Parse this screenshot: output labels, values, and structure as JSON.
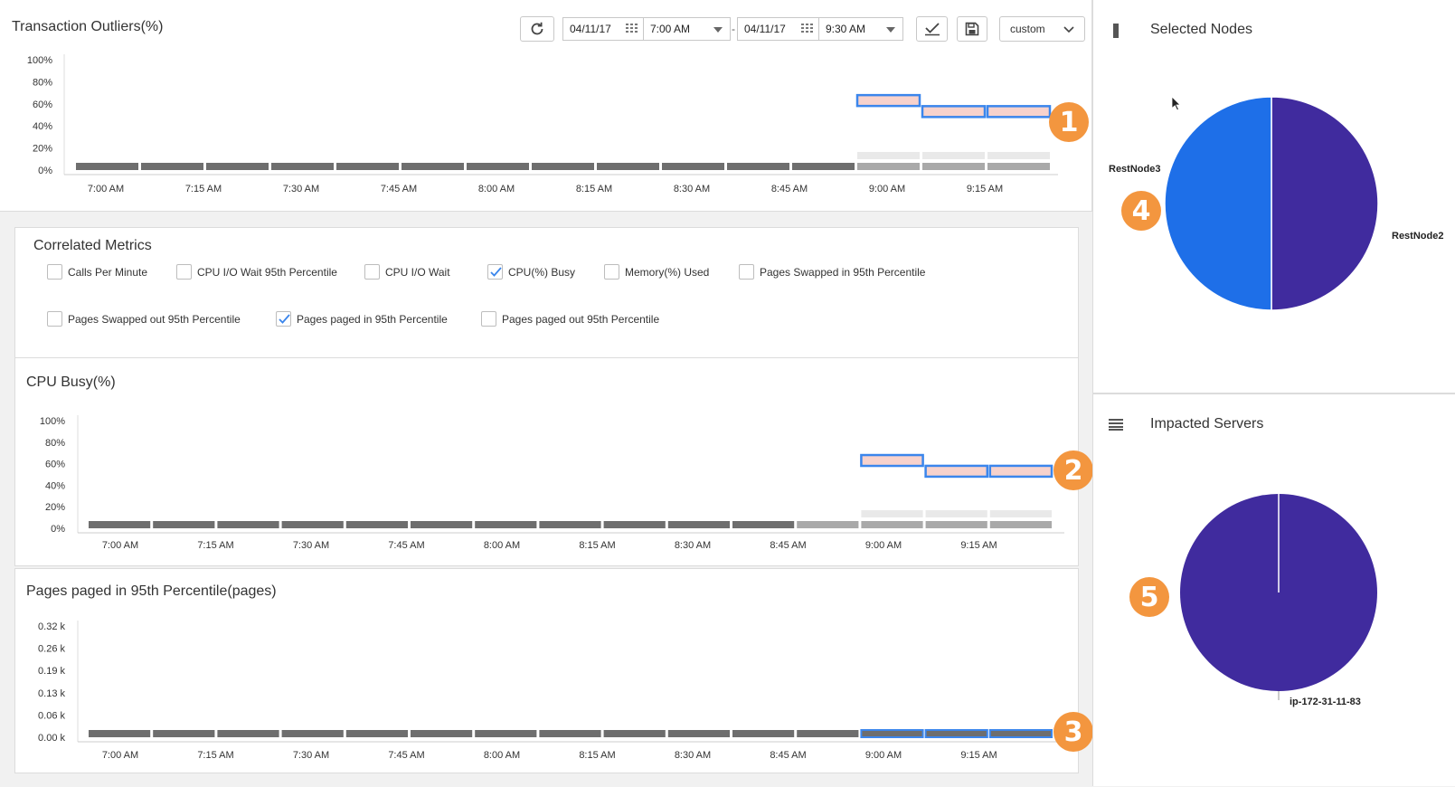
{
  "toolbar": {
    "start_date": "04/11/17",
    "start_time": "7:00 AM",
    "separator": "-",
    "end_date": "04/11/17",
    "end_time": "9:30 AM",
    "range_preset": "custom"
  },
  "correlated_metrics": {
    "title": "Correlated Metrics",
    "items": [
      {
        "label": "Calls Per Minute",
        "checked": false
      },
      {
        "label": "CPU I/O Wait 95th Percentile",
        "checked": false
      },
      {
        "label": "CPU I/O Wait",
        "checked": false
      },
      {
        "label": "CPU(%) Busy",
        "checked": true
      },
      {
        "label": "Memory(%) Used",
        "checked": false
      },
      {
        "label": "Pages Swapped in 95th Percentile",
        "checked": false
      },
      {
        "label": "Pages Swapped out 95th Percentile",
        "checked": false
      },
      {
        "label": "Pages paged in 95th Percentile",
        "checked": true
      },
      {
        "label": "Pages paged out 95th Percentile",
        "checked": false
      }
    ]
  },
  "callouts": [
    "1",
    "2",
    "3",
    "4",
    "5"
  ],
  "colors": {
    "base_bar": "#6e6e6e",
    "muted_bar": "#a9a9a9",
    "ghost_bar": "#e9e9e9",
    "outlier_fill": "#f7d2cc",
    "outlier_stroke": "#3b86ec",
    "pie_blue": "#1e6fe8",
    "pie_purple": "#402b9e",
    "badge": "#f3963f"
  },
  "chart_data": [
    {
      "type": "bar",
      "title": "Transaction Outliers(%)",
      "x": [
        "7:00 AM",
        "7:15 AM",
        "7:30 AM",
        "7:45 AM",
        "8:00 AM",
        "8:15 AM",
        "8:30 AM",
        "8:45 AM",
        "9:00 AM",
        "9:15 AM"
      ],
      "x_ticks": [
        "7:00 AM",
        "7:15 AM",
        "7:30 AM",
        "7:45 AM",
        "8:00 AM",
        "8:15 AM",
        "8:30 AM",
        "8:45 AM",
        "9:00 AM",
        "9:15 AM"
      ],
      "y_ticks": [
        "100%",
        "80%",
        "60%",
        "40%",
        "20%",
        "0%"
      ],
      "ylim": [
        0,
        100
      ],
      "bars": 15,
      "baseline_value": 3,
      "muted_from": 12,
      "highlight": [
        {
          "bar": 12,
          "value": 63
        },
        {
          "bar": 13,
          "value": 53
        },
        {
          "bar": 14,
          "value": 53
        }
      ]
    },
    {
      "type": "bar",
      "title": "CPU Busy(%)",
      "x_ticks": [
        "7:00 AM",
        "7:15 AM",
        "7:30 AM",
        "7:45 AM",
        "8:00 AM",
        "8:15 AM",
        "8:30 AM",
        "8:45 AM",
        "9:00 AM",
        "9:15 AM"
      ],
      "y_ticks": [
        "100%",
        "80%",
        "60%",
        "40%",
        "20%",
        "0%"
      ],
      "ylim": [
        0,
        100
      ],
      "bars": 15,
      "baseline_value": 3,
      "muted_from": 11,
      "highlight": [
        {
          "bar": 12,
          "value": 63
        },
        {
          "bar": 13,
          "value": 53
        },
        {
          "bar": 14,
          "value": 53
        }
      ]
    },
    {
      "type": "bar",
      "title": "Pages paged in 95th Percentile(pages)",
      "x_ticks": [
        "7:00 AM",
        "7:15 AM",
        "7:30 AM",
        "7:45 AM",
        "8:00 AM",
        "8:15 AM",
        "8:30 AM",
        "8:45 AM",
        "9:00 AM",
        "9:15 AM"
      ],
      "y_ticks": [
        "0.32 k",
        "0.26 k",
        "0.19 k",
        "0.13 k",
        "0.06 k",
        "0.00 k"
      ],
      "ylim": [
        0,
        0.32
      ],
      "bars": 15,
      "baseline_value": 0.01,
      "highlight_outline": [
        12,
        13,
        14
      ]
    },
    {
      "type": "pie",
      "title": "Selected Nodes",
      "labels": [
        "RestNode3",
        "RestNode2"
      ],
      "values": [
        50,
        50
      ],
      "colors": [
        "#1e6fe8",
        "#402b9e"
      ]
    },
    {
      "type": "pie",
      "title": "Impacted Servers",
      "labels": [
        "ip-172-31-11-83"
      ],
      "values": [
        100
      ],
      "colors": [
        "#402b9e"
      ]
    }
  ]
}
